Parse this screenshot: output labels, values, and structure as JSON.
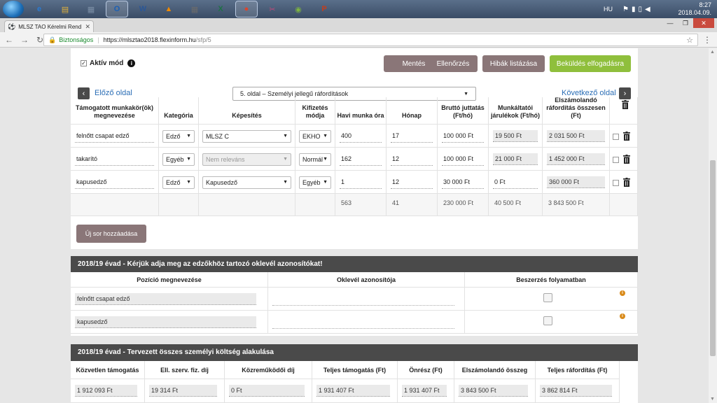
{
  "taskbar": {
    "apps": [
      {
        "name": "ie-icon",
        "glyph": "e",
        "color": "#2b7bd1"
      },
      {
        "name": "explorer-icon",
        "glyph": "▤",
        "color": "#e3b23c"
      },
      {
        "name": "calculator-icon",
        "glyph": "▦",
        "color": "#7c8fa6"
      },
      {
        "name": "outlook-icon",
        "glyph": "O",
        "color": "#1a5fb4",
        "active": true
      },
      {
        "name": "word-icon",
        "glyph": "W",
        "color": "#2b5797"
      },
      {
        "name": "vlc-icon",
        "glyph": "▲",
        "color": "#f08a00"
      },
      {
        "name": "calculator2-icon",
        "glyph": "▦",
        "color": "#6b6b6b"
      },
      {
        "name": "excel-icon",
        "glyph": "X",
        "color": "#1e7145"
      },
      {
        "name": "chrome-icon",
        "glyph": "●",
        "color": "#d9452e",
        "active": true
      },
      {
        "name": "snipping-icon",
        "glyph": "✂",
        "color": "#c04b7b"
      },
      {
        "name": "greenshot-icon",
        "glyph": "◉",
        "color": "#7cb342"
      },
      {
        "name": "powerpoint-icon",
        "glyph": "P",
        "color": "#c43e1c"
      }
    ],
    "language": "HU",
    "time": "8:27",
    "date": "2018.04.09."
  },
  "browser": {
    "tab_title": "MLSZ TAO Kérelmi Rend",
    "secure_label": "Biztonságos",
    "url_domain": "https://mlsztao2018.flexinform.hu",
    "url_path": "/sfp/5"
  },
  "toolbar": {
    "active_mode_label": "Aktív mód",
    "save": "Mentés",
    "check": "Ellenőrzés",
    "errors": "Hibák listázása",
    "submit": "Beküldés elfogadásra"
  },
  "pager": {
    "prev": "Előző oldal",
    "next": "Következő oldal",
    "current_page": "5. oldal – Személyi jellegű ráfordítások"
  },
  "staff_table": {
    "headers": [
      "Támogatott munkakör(ök) megnevezése",
      "Kategória",
      "Képesítés",
      "Kifizetés módja",
      "Havi munka óra",
      "Hónap",
      "Bruttó juttatás (Ft/hó)",
      "Munkáltatói járulékok (Ft/hó)",
      "Elszámolandó ráfordítás összesen (Ft)"
    ],
    "rows": [
      {
        "position": "felnőtt csapat edző",
        "category": "Edző",
        "qualification": "MLSZ C",
        "qual_disabled": false,
        "payment": "EKHO",
        "hours": "400",
        "months": "17",
        "gross": "100 000 Ft",
        "contrib": "19 500 Ft",
        "contrib_grey": true,
        "total": "2 031 500 Ft"
      },
      {
        "position": "takarító",
        "category": "Egyéb",
        "qualification": "Nem releváns",
        "qual_disabled": true,
        "payment": "Normál",
        "hours": "162",
        "months": "12",
        "gross": "100 000 Ft",
        "contrib": "21 000 Ft",
        "contrib_grey": true,
        "total": "1 452 000 Ft"
      },
      {
        "position": "kapusedző",
        "category": "Edző",
        "qualification": "Kapusedző",
        "qual_disabled": false,
        "payment": "Egyéb",
        "hours": "1",
        "months": "12",
        "gross": "30 000 Ft",
        "contrib": "0 Ft",
        "contrib_grey": false,
        "total": "360 000 Ft"
      }
    ],
    "sum": {
      "hours": "563",
      "months": "41",
      "gross": "230 000 Ft",
      "contrib": "40 500 Ft",
      "total": "3 843 500 Ft"
    },
    "add_row": "Új sor hozzáadása"
  },
  "diploma_section": {
    "title": "2018/19 évad - Kérjük adja meg az edzőkhöz tartozó oklevél azonosítókat!",
    "headers": [
      "Pozíció megnevezése",
      "Oklevél azonosítója",
      "Beszerzés folyamatban"
    ],
    "rows": [
      {
        "position": "felnőtt csapat edző",
        "diploma_id": ""
      },
      {
        "position": "kapusedző",
        "diploma_id": ""
      }
    ]
  },
  "cost_section": {
    "title": "2018/19 évad - Tervezett összes személyi költség alakulása",
    "headers": [
      "Közvetlen támogatás",
      "Ell. szerv. fiz. díj",
      "Közreműködői díj",
      "Teljes támogatás (Ft)",
      "Önrész (Ft)",
      "Elszámolandó összeg",
      "Teljes ráfordítás (Ft)"
    ],
    "values": [
      "1 912 093 Ft",
      "19 314 Ft",
      "0 Ft",
      "1 931 407 Ft",
      "1 931 407 Ft",
      "3 843 500 Ft",
      "3 862 814 Ft"
    ]
  },
  "colors": {
    "button_grey": "#8a7678",
    "button_green": "#8fbf3c",
    "section_header": "#4a4a4a",
    "link": "#2a6db5"
  }
}
